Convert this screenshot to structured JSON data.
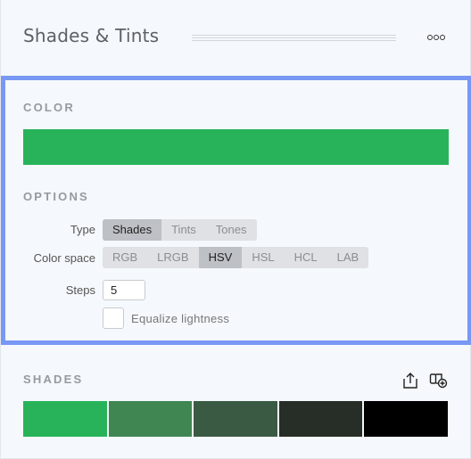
{
  "header": {
    "title": "Shades & Tints",
    "more_icon": "more-horizontal-icon"
  },
  "settings": {
    "color_label": "COLOR",
    "color": "#28b35a",
    "options_label": "OPTIONS",
    "type": {
      "label": "Type",
      "options": [
        "Shades",
        "Tints",
        "Tones"
      ],
      "selected": "Shades"
    },
    "color_space": {
      "label": "Color space",
      "options": [
        "RGB",
        "LRGB",
        "HSV",
        "HSL",
        "HCL",
        "LAB"
      ],
      "selected": "HSV"
    },
    "steps": {
      "label": "Steps",
      "value": "5"
    },
    "equalize": {
      "label": "Equalize lightness",
      "checked": false
    }
  },
  "output": {
    "label": "SHADES",
    "export_icon": "share-export-icon",
    "add_palette_icon": "add-palette-icon",
    "swatches": [
      "#28b35a",
      "#3f8653",
      "#3a5a44",
      "#272d27",
      "#000000"
    ]
  },
  "colors": {
    "accent_border": "#7898f4"
  }
}
